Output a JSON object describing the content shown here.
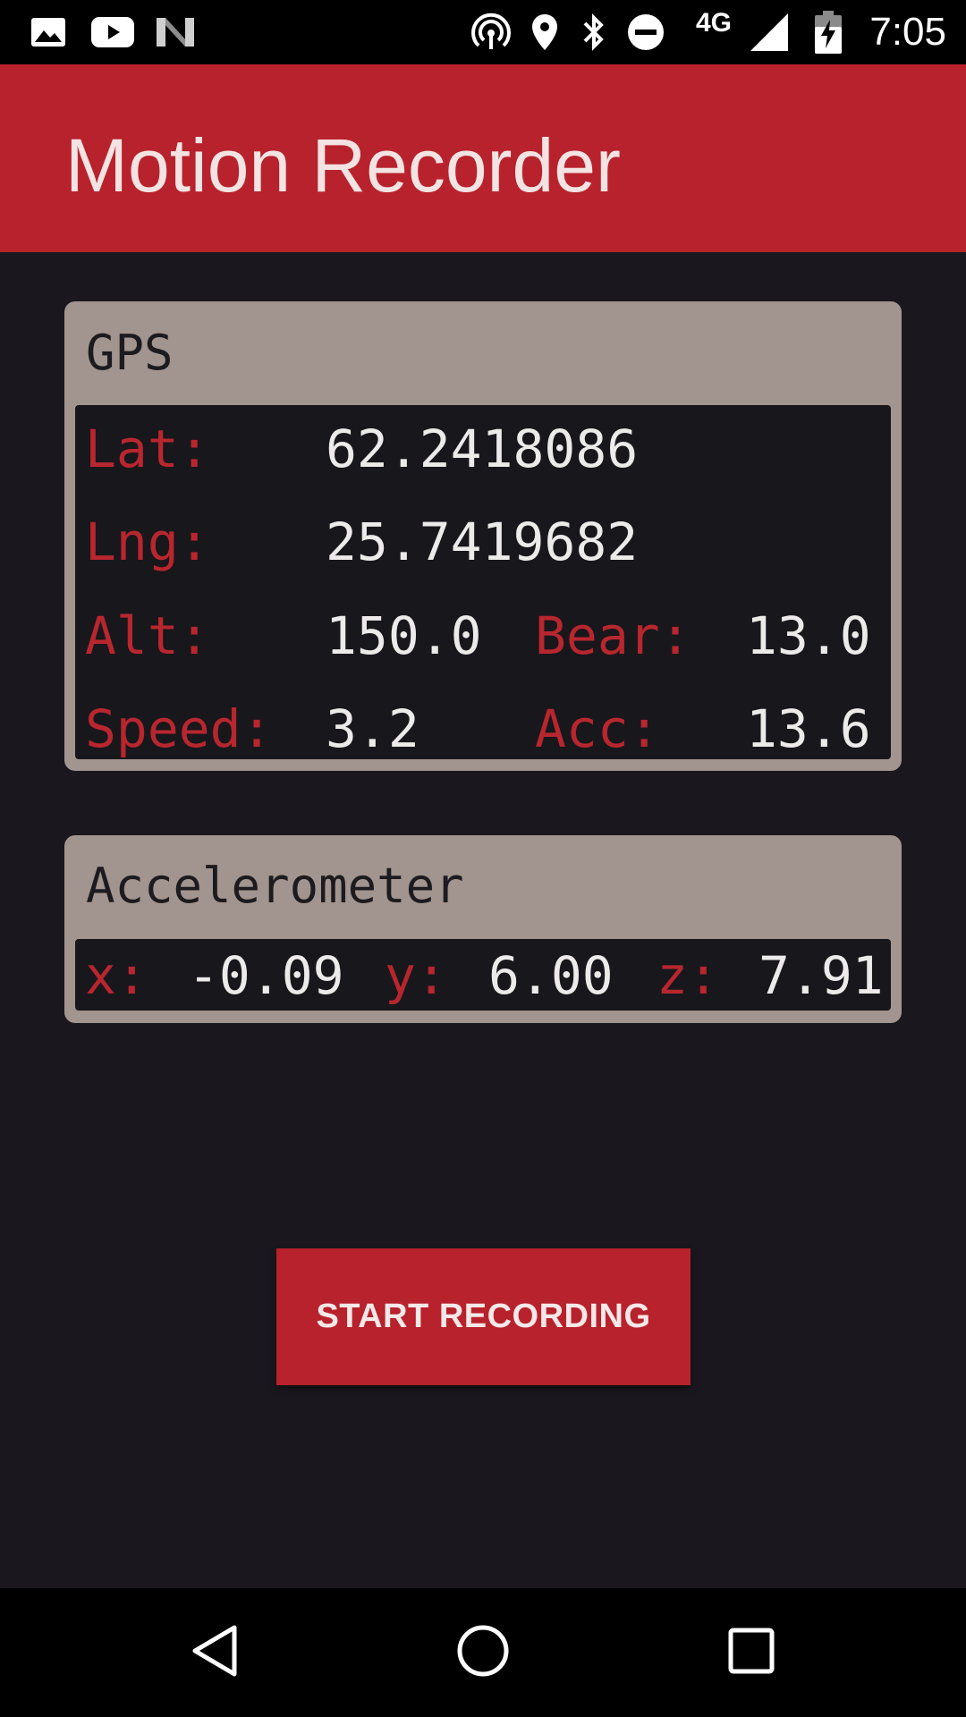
{
  "status_bar": {
    "time": "7:05",
    "network_type": "4G",
    "icons": [
      "gallery-icon",
      "youtube-icon",
      "n-icon",
      "hotspot-icon",
      "location-icon",
      "bluetooth-icon",
      "do-not-disturb-icon",
      "signal-icon",
      "battery-charging-icon"
    ]
  },
  "app_bar": {
    "title": "Motion Recorder"
  },
  "gps": {
    "title": "GPS",
    "lat_label": "Lat:",
    "lat_value": "62.2418086",
    "lng_label": "Lng:",
    "lng_value": "25.7419682",
    "alt_label": "Alt:",
    "alt_value": "150.0",
    "bear_label": "Bear:",
    "bear_value": "13.0",
    "speed_label": "Speed:",
    "speed_value": "3.2",
    "acc_label": "Acc:",
    "acc_value": "13.6"
  },
  "accelerometer": {
    "title": "Accelerometer",
    "x_label": "x:",
    "x_value": "-0.09",
    "y_label": "y:",
    "y_value": "6.00",
    "z_label": "z:",
    "z_value": "7.91"
  },
  "actions": {
    "start_label": "START RECORDING"
  },
  "nav_bar": {
    "icons": [
      "back-icon",
      "home-icon",
      "recents-icon"
    ]
  },
  "colors": {
    "accent": "#b8222c",
    "background": "#1a181e",
    "card": "#a2948e",
    "label": "#b8262e",
    "value": "#ecebea"
  }
}
